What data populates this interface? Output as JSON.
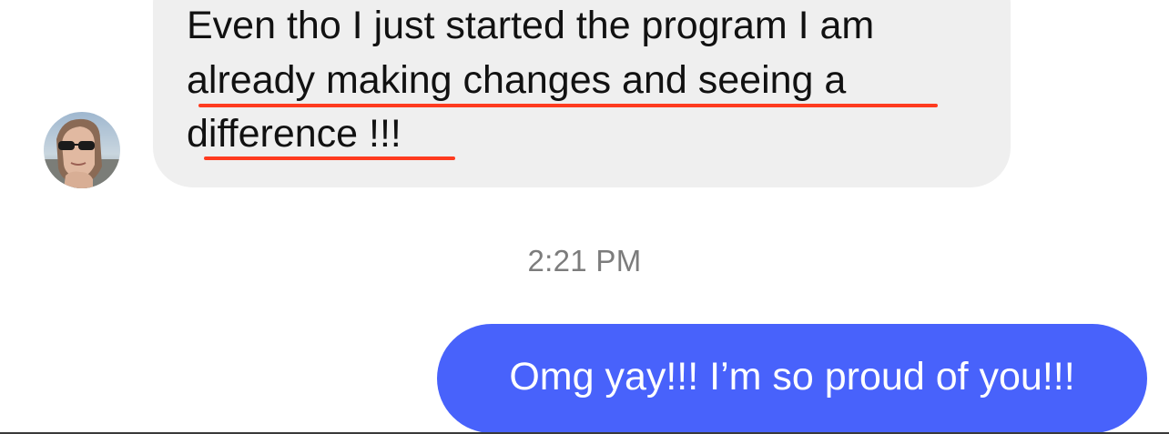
{
  "conversation": {
    "incoming_message": {
      "lines": [
        "Even tho I just started the program I am",
        "already making changes and seeing a",
        "difference !!!"
      ],
      "underline_color": "#ff3b1f",
      "bubble_color": "#efefef"
    },
    "avatar": {
      "icon": "profile-photo-avatar"
    },
    "timestamp": "2:21 PM",
    "outgoing_message": {
      "text": "Omg yay!!! I’m so proud of you!!!",
      "bubble_color": "#4862fb"
    }
  }
}
